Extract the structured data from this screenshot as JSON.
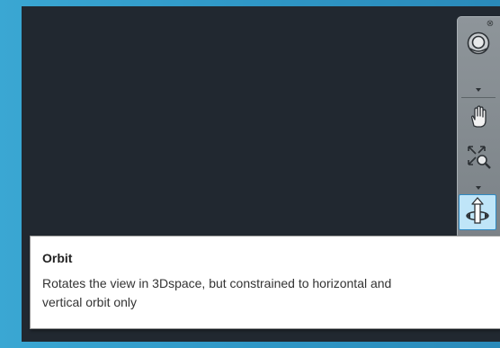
{
  "navigation_bar": {
    "close_icon": "close-icon",
    "tools": [
      {
        "name": "steering-wheel",
        "icon": "steering-wheel-icon"
      },
      {
        "name": "pan",
        "icon": "pan-hand-icon"
      },
      {
        "name": "zoom-extents",
        "icon": "zoom-extents-icon"
      },
      {
        "name": "orbit",
        "icon": "orbit-icon",
        "active": true
      }
    ]
  },
  "tooltip": {
    "title": "Orbit",
    "description_line1": "Rotates the view in 3Dspace, but constrained to horizontal and",
    "description_line2": "vertical orbit only"
  },
  "colors": {
    "viewport_bg": "#212830",
    "frame_bg": "#3aa6d2",
    "navbar_bg": "#858c91",
    "active_highlight": "#bfe5f8",
    "active_border": "#2e89c2"
  }
}
